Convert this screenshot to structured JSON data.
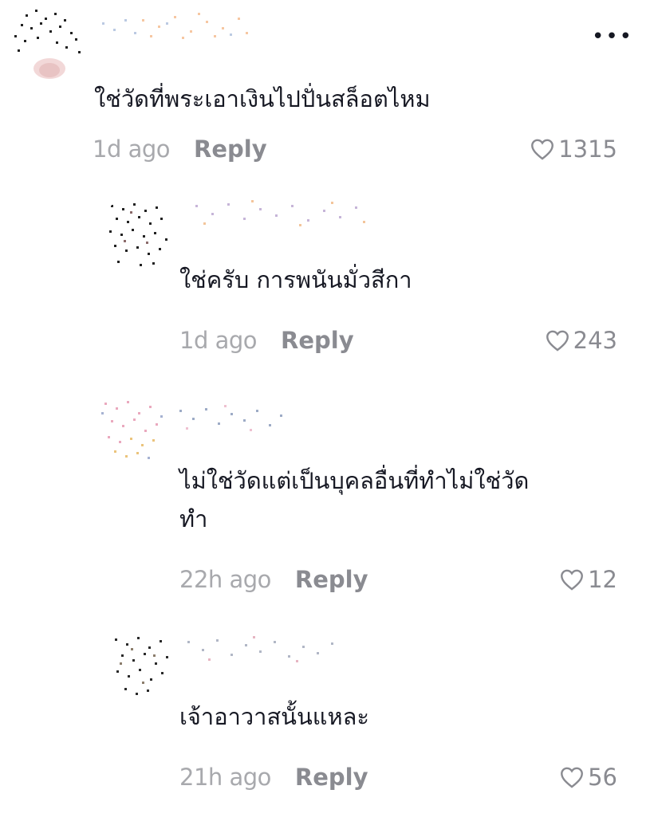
{
  "menu_icon": "more-horizontal-icon",
  "more_label": "•••",
  "comments": [
    {
      "avatar": "blurred-avatar",
      "text": "ใช่วัดที่พระเอาเงินไปปั่นสล็อตไหม",
      "time": "1d ago",
      "reply_label": "Reply",
      "likes": "1315"
    },
    {
      "avatar": "blurred-avatar",
      "text": "ใช่ครับ การพนันมั่วสีกา",
      "time": "1d ago",
      "reply_label": "Reply",
      "likes": "243"
    },
    {
      "avatar": "blurred-avatar",
      "text": "ไม่ใช่วัดแต่เป็นบุคลอื่นที่ทำไม่ใช่วัด\nทำ",
      "time": "22h ago",
      "reply_label": "Reply",
      "likes": "12"
    },
    {
      "avatar": "blurred-avatar",
      "text": "เจ้าอาวาสนั้นแหละ",
      "time": "21h ago",
      "reply_label": "Reply",
      "likes": "56"
    }
  ],
  "colors": {
    "text": "#161823",
    "muted": "#a8a9ad",
    "reply": "#8a8b91"
  }
}
